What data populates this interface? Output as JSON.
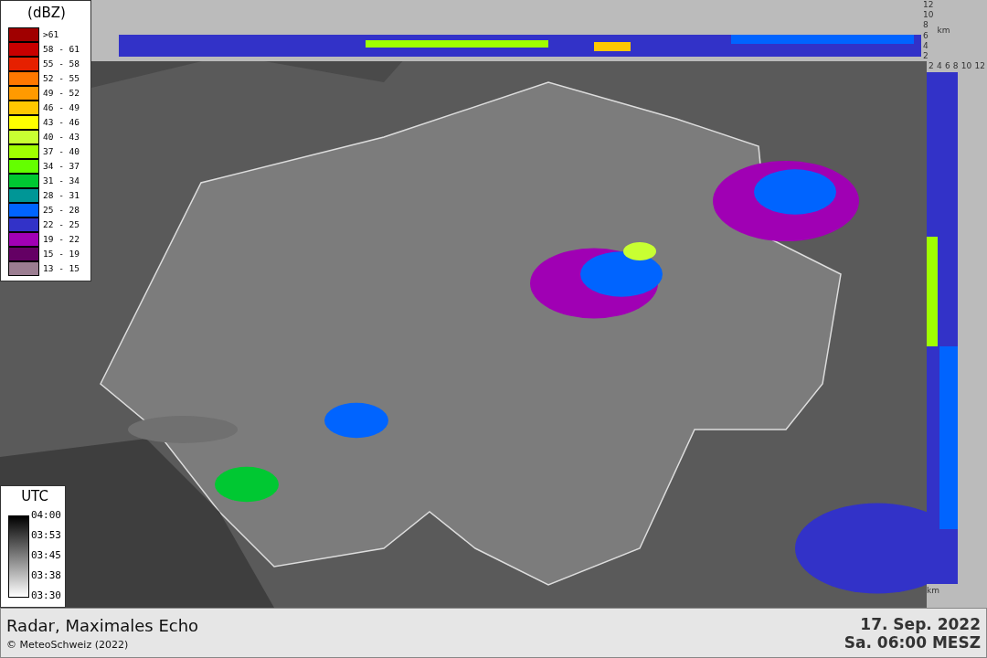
{
  "legend": {
    "title": "(dBZ)",
    "items": [
      {
        "label": ">61",
        "color": "#a00000"
      },
      {
        "label": "58 - 61",
        "color": "#c80000"
      },
      {
        "label": "55 - 58",
        "color": "#e62000"
      },
      {
        "label": "52 - 55",
        "color": "#ff7800"
      },
      {
        "label": "49 - 52",
        "color": "#ff9a00"
      },
      {
        "label": "46 - 49",
        "color": "#ffc800"
      },
      {
        "label": "43 - 46",
        "color": "#ffff00"
      },
      {
        "label": "40 - 43",
        "color": "#c8ff32"
      },
      {
        "label": "37 - 40",
        "color": "#a0ff00"
      },
      {
        "label": "34 - 37",
        "color": "#64ff00"
      },
      {
        "label": "31 - 34",
        "color": "#00c832"
      },
      {
        "label": "28 - 31",
        "color": "#009696"
      },
      {
        "label": "25 - 28",
        "color": "#0064ff"
      },
      {
        "label": "22 - 25",
        "color": "#3232c8"
      },
      {
        "label": "19 - 22",
        "color": "#a000b4"
      },
      {
        "label": "15 - 19",
        "color": "#640064"
      },
      {
        "label": "13 - 15",
        "color": "#9b7d91"
      }
    ]
  },
  "time_legend": {
    "title": "UTC",
    "ticks": [
      "04:00",
      "03:53",
      "03:45",
      "03:38",
      "03:30"
    ]
  },
  "top_profile": {
    "ticks": [
      "12",
      "10",
      "8",
      "6",
      "4",
      "2"
    ],
    "unit": "km"
  },
  "side_profile": {
    "ticks": [
      "2",
      "4",
      "6",
      "8",
      "10",
      "12"
    ],
    "unit": "km"
  },
  "footer": {
    "title": "Radar, Maximales Echo",
    "copyright": "© MeteoSchweiz (2022)",
    "date": "17. Sep. 2022",
    "time": "Sa. 06:00 MESZ"
  }
}
